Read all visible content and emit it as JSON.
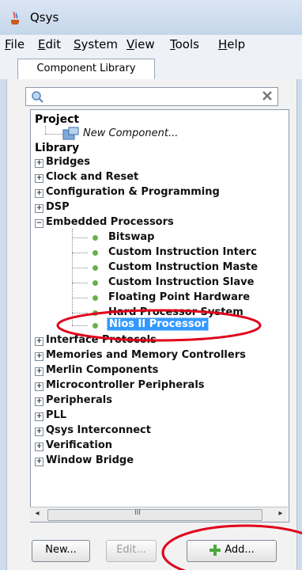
{
  "window": {
    "title": "Qsys",
    "icon": "java-cup-icon"
  },
  "menu": [
    {
      "label": "File",
      "mnemonic": "F",
      "rest": "ile"
    },
    {
      "label": "Edit",
      "mnemonic": "E",
      "rest": "dit"
    },
    {
      "label": "System",
      "mnemonic": "S",
      "rest": "ystem"
    },
    {
      "label": "View",
      "mnemonic": "V",
      "rest": "iew"
    },
    {
      "label": "Tools",
      "mnemonic": "T",
      "rest": "ools"
    },
    {
      "label": "Help",
      "mnemonic": "H",
      "rest": "elp"
    }
  ],
  "tab": {
    "label": "Component Library"
  },
  "search": {
    "value": "",
    "icon": "search-icon",
    "clear_icon": "clear-icon"
  },
  "tree": {
    "project_heading": "Project",
    "new_component": "New Component...",
    "library_heading": "Library",
    "categories": [
      "Bridges",
      "Clock and Reset",
      "Configuration & Programming",
      "DSP",
      "Embedded Processors",
      "Interface Protocols",
      "Memories and Memory Controllers",
      "Merlin Components",
      "Microcontroller Peripherals",
      "Peripherals",
      "PLL",
      "Qsys Interconnect",
      "Verification",
      "Window Bridge"
    ],
    "embedded_children": [
      "Bitswap",
      "Custom Instruction Interc",
      "Custom Instruction Maste",
      "Custom Instruction Slave",
      "Floating Point Hardware",
      "Hard Processor System",
      "Nios II Processor"
    ],
    "selected": "Nios II Processor"
  },
  "scrollbar": {
    "left_arrow": "◂",
    "right_arrow": "▸",
    "grip": "III"
  },
  "buttons": {
    "new": "New...",
    "edit": "Edit...",
    "add": "Add..."
  },
  "colors": {
    "selection": "#3399ff",
    "annotation": "#e0001b",
    "leaf": "#6ab04c"
  }
}
